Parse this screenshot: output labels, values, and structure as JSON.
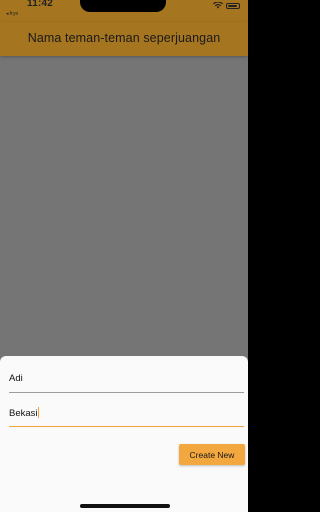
{
  "status_bar": {
    "time": "11:42",
    "back_app": "◂ fryo",
    "icons": [
      "wifi-icon",
      "battery-icon"
    ]
  },
  "app_bar": {
    "title": "Nama teman-teman seperjuangan"
  },
  "sheet": {
    "name_field": {
      "value": "Adi"
    },
    "address_field": {
      "value": "Bekasi"
    },
    "create_button": {
      "label": "Create New"
    }
  },
  "colors": {
    "accent": "#f2a73f",
    "app_bar_dimmed": "#a6751f",
    "scrim": "#757575",
    "sheet": "#fafafa"
  }
}
